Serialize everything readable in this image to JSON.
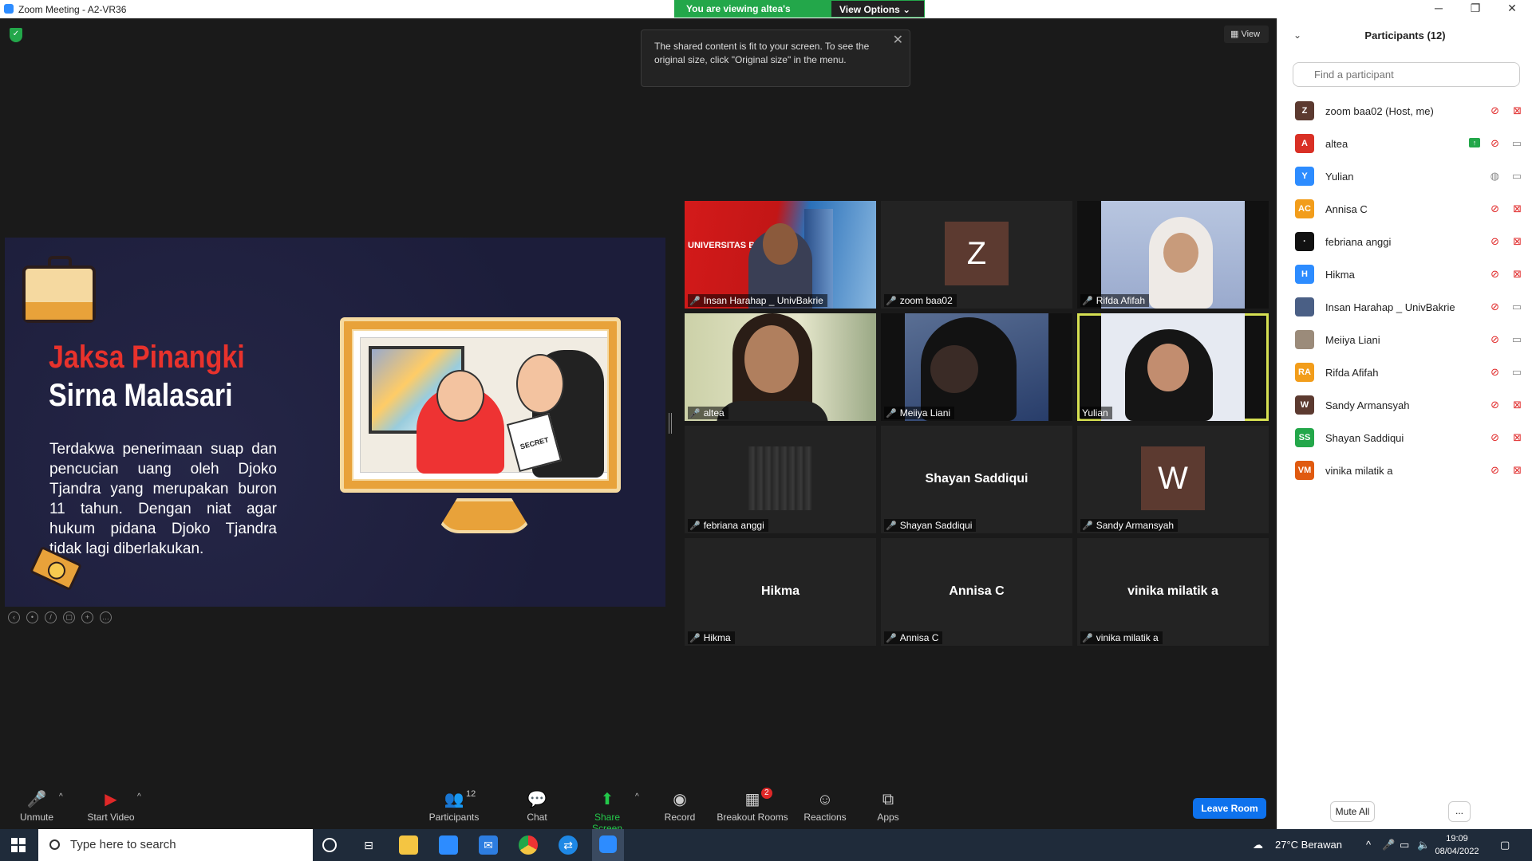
{
  "window": {
    "title": "Zoom Meeting - A2-VR36",
    "minimize": "─",
    "restore": "❐",
    "close": "✕"
  },
  "banner": {
    "viewing": "You are viewing altea's screen",
    "view_options": "View Options ⌄"
  },
  "view_button": "▦ View",
  "tooltip": "The shared content is fit to your screen. To see the original size, click \"Original size\" in the menu.",
  "slide": {
    "heading_red": "Jaksa Pinangki",
    "heading_white": "Sirna Malasari",
    "body": "Terdakwa penerimaan suap dan pencucian uang oleh Djoko Tjandra yang merupakan buron 11 tahun. Dengan niat agar hukum pidana Djoko Tjandra tidak lagi diberlakukan.",
    "paper_text": "SECRET"
  },
  "video_tiles": [
    {
      "name": "Insan Harahap _ UnivBakrie",
      "kind": "video",
      "logo": "UNIVERSITAS BAKRIE"
    },
    {
      "name": "zoom baa02",
      "kind": "letter",
      "letter": "Z"
    },
    {
      "name": "Rifda Afifah",
      "kind": "video"
    },
    {
      "name": "altea",
      "kind": "video"
    },
    {
      "name": "Meiiya Liani",
      "kind": "video"
    },
    {
      "name": "Yulian",
      "kind": "video",
      "active": true
    },
    {
      "name": "febriana anggi",
      "kind": "image"
    },
    {
      "name": "Shayan Saddiqui",
      "kind": "name"
    },
    {
      "name": "Sandy Armansyah",
      "kind": "letter",
      "letter": "W"
    },
    {
      "name": "Hikma",
      "kind": "name"
    },
    {
      "name": "Annisa C",
      "kind": "name"
    },
    {
      "name": "vinika milatik a",
      "kind": "name"
    }
  ],
  "participants": {
    "title": "Participants (12)",
    "collapse": "⌄",
    "search_placeholder": "Find a participant",
    "list": [
      {
        "initials": "Z",
        "color": "#5c3a30",
        "name": "zoom baa02 (Host, me)",
        "mic": "off",
        "cam": "off"
      },
      {
        "initials": "A",
        "color": "#d93025",
        "name": "altea",
        "mic": "off",
        "cam": "on",
        "sharing": true
      },
      {
        "initials": "Y",
        "color": "#2d8cff",
        "name": "Yulian",
        "mic": "on",
        "cam": "on"
      },
      {
        "initials": "AC",
        "color": "#f29d1b",
        "name": "Annisa C",
        "mic": "off",
        "cam": "off"
      },
      {
        "initials": "·",
        "color": "#111111",
        "name": "febriana anggi",
        "mic": "off",
        "cam": "off"
      },
      {
        "initials": "H",
        "color": "#2d8cff",
        "name": "Hikma",
        "mic": "off",
        "cam": "off"
      },
      {
        "initials": "",
        "color": "#4a5f85",
        "name": "Insan Harahap _ UnivBakrie",
        "mic": "off",
        "cam": "on"
      },
      {
        "initials": "",
        "color": "#9b8b7a",
        "name": "Meiiya Liani",
        "mic": "off",
        "cam": "on"
      },
      {
        "initials": "RA",
        "color": "#f29d1b",
        "name": "Rifda Afifah",
        "mic": "off",
        "cam": "on"
      },
      {
        "initials": "W",
        "color": "#5c3a30",
        "name": "Sandy Armansyah",
        "mic": "off",
        "cam": "off"
      },
      {
        "initials": "SS",
        "color": "#23a74a",
        "name": "Shayan Saddiqui",
        "mic": "off",
        "cam": "off"
      },
      {
        "initials": "VM",
        "color": "#e05a10",
        "name": "vinika milatik a",
        "mic": "off",
        "cam": "off"
      }
    ],
    "mute_all": "Mute All",
    "more": "..."
  },
  "toolbar": {
    "unmute": "Unmute",
    "start_video": "Start Video",
    "participants": "Participants",
    "participants_count": "12",
    "chat": "Chat",
    "share_screen": "Share Screen",
    "record": "Record",
    "breakout_rooms": "Breakout Rooms",
    "breakout_badge": "2",
    "reactions": "Reactions",
    "apps": "Apps",
    "leave_room": "Leave Room"
  },
  "taskbar": {
    "search_placeholder": "Type here to search",
    "weather": "27°C  Berawan",
    "time": "19:09",
    "date": "08/04/2022"
  },
  "colors": {
    "zoom_blue": "#0e72ed",
    "share_green": "#23a74a",
    "muted_red": "#e02828",
    "active_speaker": "#d6e052"
  }
}
